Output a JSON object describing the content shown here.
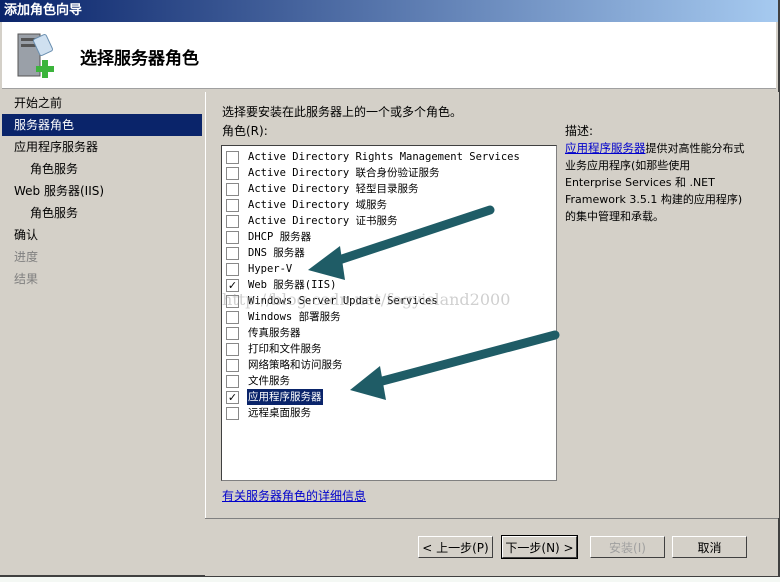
{
  "window": {
    "title": "添加角色向导"
  },
  "header": {
    "title": "选择服务器角色",
    "icon": "server-add-icon"
  },
  "nav": {
    "items": [
      {
        "label": "开始之前",
        "state": "normal",
        "sub": false
      },
      {
        "label": "服务器角色",
        "state": "selected",
        "sub": false
      },
      {
        "label": "应用程序服务器",
        "state": "normal",
        "sub": false
      },
      {
        "label": "角色服务",
        "state": "normal",
        "sub": true
      },
      {
        "label": "Web 服务器(IIS)",
        "state": "normal",
        "sub": false
      },
      {
        "label": "角色服务",
        "state": "normal",
        "sub": true
      },
      {
        "label": "确认",
        "state": "normal",
        "sub": false
      },
      {
        "label": "进度",
        "state": "disabled",
        "sub": false
      },
      {
        "label": "结果",
        "state": "disabled",
        "sub": false
      }
    ]
  },
  "main": {
    "instruction": "选择要安装在此服务器上的一个或多个角色。",
    "roles_label": "角色(R):",
    "roles": [
      {
        "label": "Active Directory Rights Management Services",
        "checked": false
      },
      {
        "label": "Active Directory 联合身份验证服务",
        "checked": false
      },
      {
        "label": "Active Directory 轻型目录服务",
        "checked": false
      },
      {
        "label": "Active Directory 域服务",
        "checked": false
      },
      {
        "label": "Active Directory 证书服务",
        "checked": false
      },
      {
        "label": "DHCP 服务器",
        "checked": false
      },
      {
        "label": "DNS 服务器",
        "checked": false
      },
      {
        "label": "Hyper-V",
        "checked": false
      },
      {
        "label": "Web 服务器(IIS)",
        "checked": true
      },
      {
        "label": "Windows Server Update Services",
        "checked": false
      },
      {
        "label": "Windows 部署服务",
        "checked": false
      },
      {
        "label": "传真服务器",
        "checked": false
      },
      {
        "label": "打印和文件服务",
        "checked": false
      },
      {
        "label": "网络策略和访问服务",
        "checked": false
      },
      {
        "label": "文件服务",
        "checked": false
      },
      {
        "label": "应用程序服务器",
        "checked": true,
        "selected": true
      },
      {
        "label": "远程桌面服务",
        "checked": false
      }
    ],
    "more_info_link": "有关服务器角色的详细信息",
    "description_label": "描述:",
    "description_link": "应用程序服务器",
    "description_text": "提供对高性能分布式业务应用程序(如那些使用 Enterprise Services 和 .NET Framework 3.5.1 构建的应用程序)的集中管理和承载。"
  },
  "buttons": {
    "back": "< 上一步(P)",
    "next": "下一步(N) >",
    "install": "安装(I)",
    "cancel": "取消"
  },
  "watermark": "http://blog.csdn.net/fogyisland2000",
  "annotation_color": "#1f5c66"
}
